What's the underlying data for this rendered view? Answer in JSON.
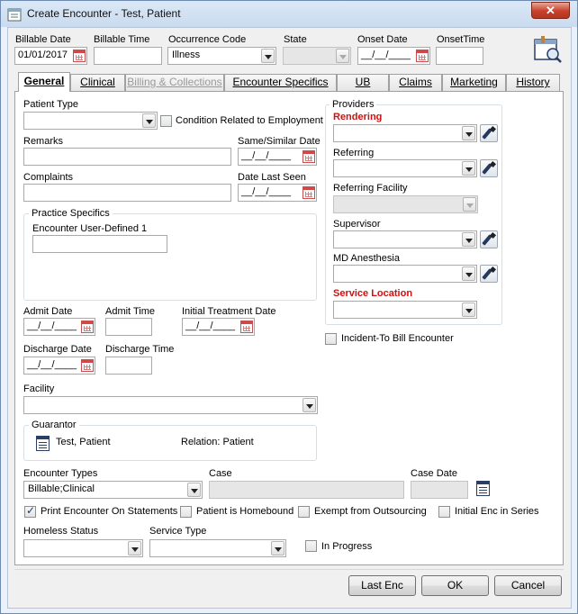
{
  "window": {
    "title": "Create Encounter - Test, Patient",
    "close_label": "✕"
  },
  "header": {
    "billable_date_label": "Billable Date",
    "billable_date_value": "01/01/2017",
    "billable_time_label": "Billable Time",
    "billable_time_value": "",
    "occurrence_code_label": "Occurrence Code",
    "occurrence_code_value": "Illness",
    "state_label": "State",
    "state_value": "",
    "onset_date_label": "Onset Date",
    "onset_date_value": "__/__/____",
    "onset_time_label": "OnsetTime",
    "onset_time_value": ""
  },
  "tabs": [
    {
      "label": "General",
      "state": "active"
    },
    {
      "label": "Clinical",
      "state": "normal"
    },
    {
      "label": "Billing & Collections",
      "state": "disabled"
    },
    {
      "label": "Encounter Specifics",
      "state": "normal"
    },
    {
      "label": "UB",
      "state": "normal"
    },
    {
      "label": "Claims",
      "state": "normal"
    },
    {
      "label": "Marketing",
      "state": "normal"
    },
    {
      "label": "History",
      "state": "normal"
    }
  ],
  "general": {
    "patient_type_label": "Patient Type",
    "patient_type_value": "",
    "condition_related_label": "Condition Related to Employment",
    "condition_related_checked": false,
    "remarks_label": "Remarks",
    "remarks_value": "",
    "same_similar_date_label": "Same/Similar Date",
    "same_similar_date_value": "__/__/____",
    "complaints_label": "Complaints",
    "complaints_value": "",
    "date_last_seen_label": "Date Last Seen",
    "date_last_seen_value": "__/__/____",
    "practice_specifics_title": "Practice Specifics",
    "encounter_user_defined_label": "Encounter User-Defined 1",
    "encounter_user_defined_value": "",
    "admit_date_label": "Admit Date",
    "admit_date_value": "__/__/____",
    "admit_time_label": "Admit Time",
    "admit_time_value": "",
    "initial_treatment_date_label": "Initial Treatment Date",
    "initial_treatment_date_value": "__/__/____",
    "discharge_date_label": "Discharge Date",
    "discharge_date_value": "__/__/____",
    "discharge_time_label": "Discharge Time",
    "discharge_time_value": "",
    "facility_label": "Facility",
    "facility_value": "",
    "guarantor_title": "Guarantor",
    "guarantor_name": "Test, Patient",
    "guarantor_relation": "Relation:  Patient",
    "encounter_types_label": "Encounter Types",
    "encounter_types_value": "Billable;Clinical",
    "case_label": "Case",
    "case_value": "",
    "case_date_label": "Case Date",
    "case_date_value": "",
    "print_on_statements_label": "Print Encounter On Statements",
    "print_on_statements_checked": true,
    "homebound_label": "Patient is Homebound",
    "homebound_checked": false,
    "exempt_outsourcing_label": "Exempt from Outsourcing",
    "exempt_outsourcing_checked": false,
    "initial_enc_series_label": "Initial Enc in Series",
    "initial_enc_series_checked": false,
    "homeless_status_label": "Homeless Status",
    "homeless_status_value": "",
    "service_type_label": "Service Type",
    "service_type_value": "",
    "in_progress_label": "In Progress",
    "in_progress_checked": false
  },
  "providers": {
    "title": "Providers",
    "rendering_label": "Rendering",
    "rendering_value": "",
    "referring_label": "Referring",
    "referring_value": "",
    "referring_facility_label": "Referring Facility",
    "referring_facility_value": "",
    "supervisor_label": "Supervisor",
    "supervisor_value": "",
    "md_anesthesia_label": "MD Anesthesia",
    "md_anesthesia_value": "",
    "service_location_label": "Service Location",
    "service_location_value": "",
    "incident_to_label": "Incident-To Bill Encounter",
    "incident_to_checked": false
  },
  "footer": {
    "last_enc_label": "Last Enc",
    "ok_label": "OK",
    "cancel_label": "Cancel"
  },
  "colors": {
    "required_label": "#d01010",
    "title_bar": "#c9dbef",
    "close_button": "#c7402a"
  }
}
